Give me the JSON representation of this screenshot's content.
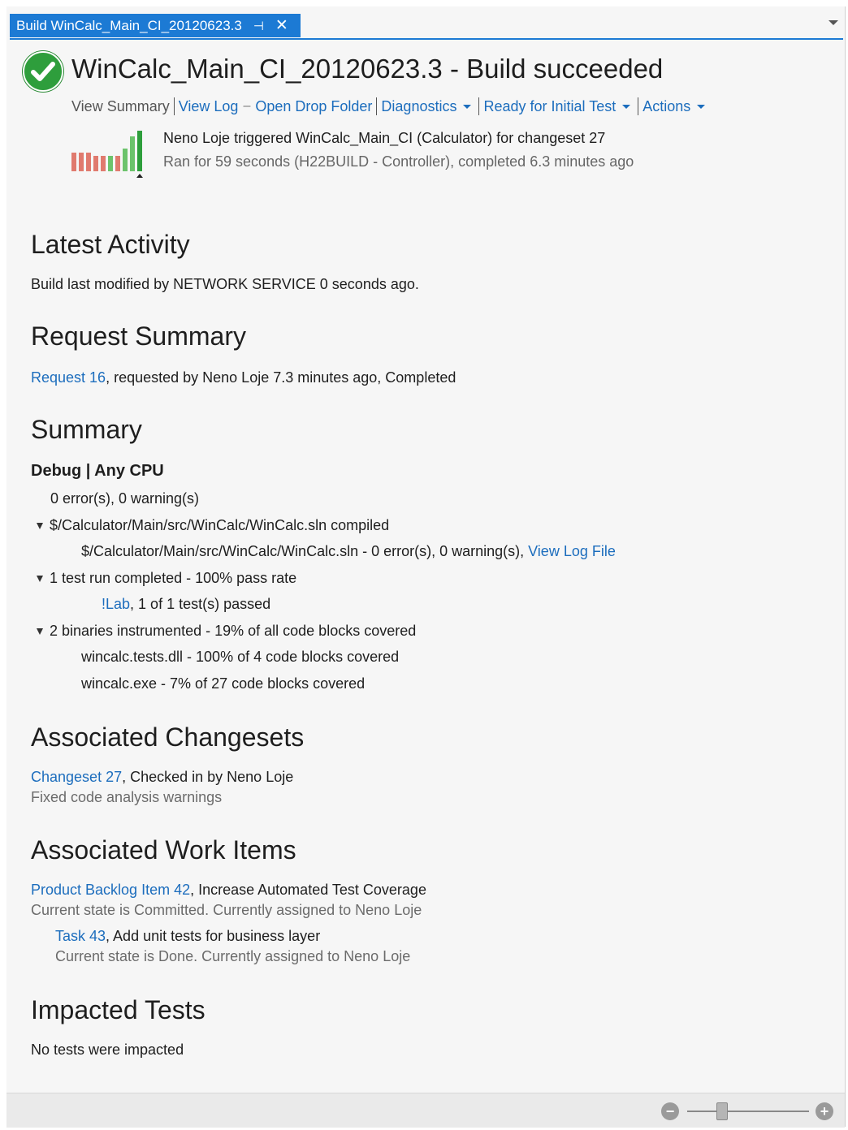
{
  "tab": {
    "label": "Build WinCalc_Main_CI_20120623.3",
    "pin_glyph": "⊣",
    "close_glyph": "✕"
  },
  "header": {
    "title": "WinCalc_Main_CI_20120623.3 - Build succeeded",
    "status_color": "#2e9e3c",
    "links": {
      "view_summary": "View Summary",
      "view_log": "View Log",
      "separator_dash": "–",
      "open_drop_folder": "Open Drop Folder",
      "diagnostics": "Diagnostics",
      "ready_for_initial_test": "Ready for Initial Test",
      "actions": "Actions"
    },
    "trigger_line": "Neno Loje triggered WinCalc_Main_CI (Calculator) for changeset 27",
    "run_line": "Ran for 59 seconds (H22BUILD - Controller), completed 6.3 minutes ago",
    "history_bars": [
      {
        "status": "failed",
        "level": 0.45
      },
      {
        "status": "failed",
        "level": 0.45
      },
      {
        "status": "failed",
        "level": 0.45
      },
      {
        "status": "failed",
        "level": 0.38
      },
      {
        "status": "failed",
        "level": 0.38
      },
      {
        "status": "succeeded",
        "level": 0.38
      },
      {
        "status": "failed",
        "level": 0.38
      },
      {
        "status": "succeeded",
        "level": 0.55
      },
      {
        "status": "succeeded",
        "level": 0.85
      },
      {
        "status": "current",
        "level": 1.0
      }
    ],
    "history_colors": {
      "failed": "#e07a6e",
      "succeeded": "#6cc36c",
      "current": "#2e9e3c"
    }
  },
  "latest_activity": {
    "heading": "Latest Activity",
    "text": "Build last modified by NETWORK SERVICE 0 seconds ago."
  },
  "request_summary": {
    "heading": "Request Summary",
    "link": "Request 16",
    "text": ", requested by Neno Loje 7.3 minutes ago, Completed"
  },
  "summary": {
    "heading": "Summary",
    "config": "Debug | Any CPU",
    "errors_line": "0 error(s), 0 warning(s)",
    "compiled_line": "$/Calculator/Main/src/WinCalc/WinCalc.sln compiled",
    "compiled_detail": "$/Calculator/Main/src/WinCalc/WinCalc.sln - 0 error(s), 0 warning(s), ",
    "view_log_file": "View Log File",
    "test_run_line": "1 test run completed - 100% pass rate",
    "lab_link": "!Lab",
    "lab_text": ", 1 of 1 test(s) passed",
    "binaries_line": "2 binaries instrumented - 19% of all code blocks covered",
    "binary_1": "wincalc.tests.dll - 100% of 4 code blocks covered",
    "binary_2": "wincalc.exe - 7% of 27 code blocks covered"
  },
  "changesets": {
    "heading": "Associated Changesets",
    "link": "Changeset 27",
    "text": ", Checked in by Neno Loje",
    "comment": "Fixed code analysis warnings"
  },
  "work_items": {
    "heading": "Associated Work Items",
    "item1_link": "Product Backlog Item 42",
    "item1_text": ", Increase Automated Test Coverage",
    "item1_state": "Current state is Committed. Currently assigned to Neno Loje",
    "item2_link": "Task 43",
    "item2_text": ", Add unit tests for business layer",
    "item2_state": "Current state is Done. Currently assigned to Neno Loje"
  },
  "impacted_tests": {
    "heading": "Impacted Tests",
    "text": "No tests were impacted"
  },
  "zoom": {
    "minus": "−",
    "plus": "+",
    "level": 0.2
  }
}
